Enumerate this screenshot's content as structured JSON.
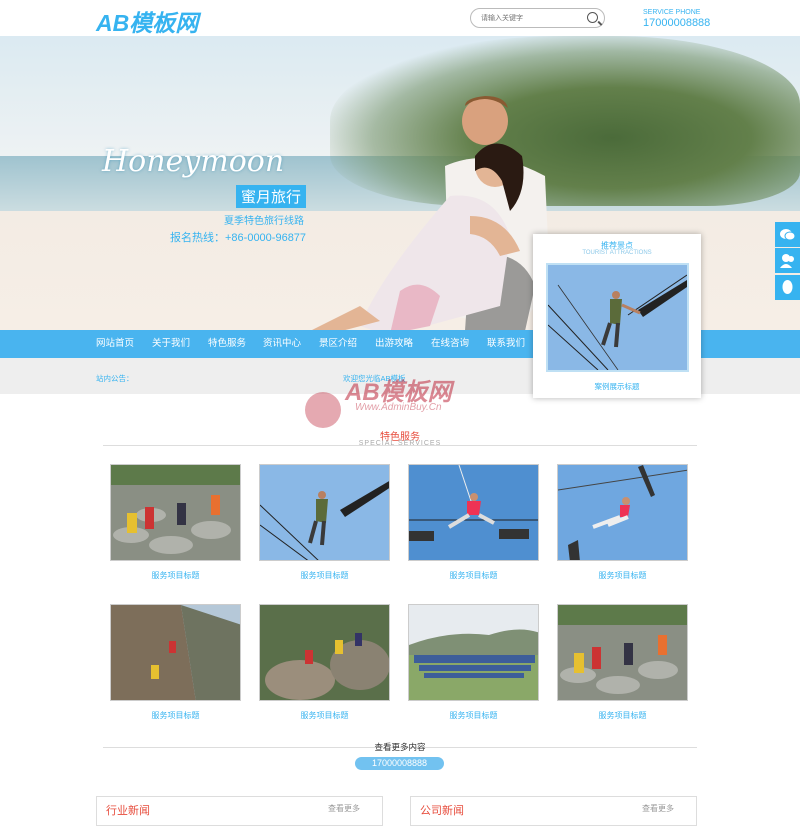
{
  "header": {
    "logo": "AB模板网",
    "search_placeholder": "请输入关键字",
    "service_label": "SERVICE PHONE",
    "service_phone": "17000008888"
  },
  "banner": {
    "script_title": "Honeymoon",
    "cn_title": "蜜月旅行",
    "subtitle": "夏季特色旅行线路",
    "hotline": "报名热线：+86-0000-96877"
  },
  "nav": {
    "items": [
      {
        "label": "网站首页"
      },
      {
        "label": "关于我们"
      },
      {
        "label": "特色服务"
      },
      {
        "label": "资讯中心"
      },
      {
        "label": "景区介绍"
      },
      {
        "label": "出游攻略"
      },
      {
        "label": "在线咨询"
      },
      {
        "label": "联系我们"
      }
    ]
  },
  "notice": {
    "label": "站内公告：",
    "text": "欢迎您光临AB模板"
  },
  "popup": {
    "title": "推荐景点",
    "subtitle": "TOURIST ATTRACTIONS",
    "caption": "案例展示标题"
  },
  "watermark": {
    "logo": "AB模板网",
    "url": "Www.AdminBuy.Cn"
  },
  "services": {
    "title": "特色服务",
    "subtitle": "SPECIAL SERVICES",
    "items": [
      {
        "caption": "服务项目标题"
      },
      {
        "caption": "服务项目标题"
      },
      {
        "caption": "服务项目标题"
      },
      {
        "caption": "服务项目标题"
      },
      {
        "caption": "服务项目标题"
      },
      {
        "caption": "服务项目标题"
      },
      {
        "caption": "服务项目标题"
      },
      {
        "caption": "服务项目标题"
      }
    ],
    "more_text": "查看更多内容",
    "more_phone": "17000008888"
  },
  "news": [
    {
      "title": "行业新闻",
      "more": "查看更多"
    },
    {
      "title": "公司新闻",
      "more": "查看更多"
    }
  ],
  "colors": {
    "accent": "#36b3f0",
    "nav": "#49b4ef",
    "heading": "#e74c3c"
  },
  "icons": [
    "search-icon",
    "wechat-icon",
    "user-icon",
    "qq-icon"
  ]
}
